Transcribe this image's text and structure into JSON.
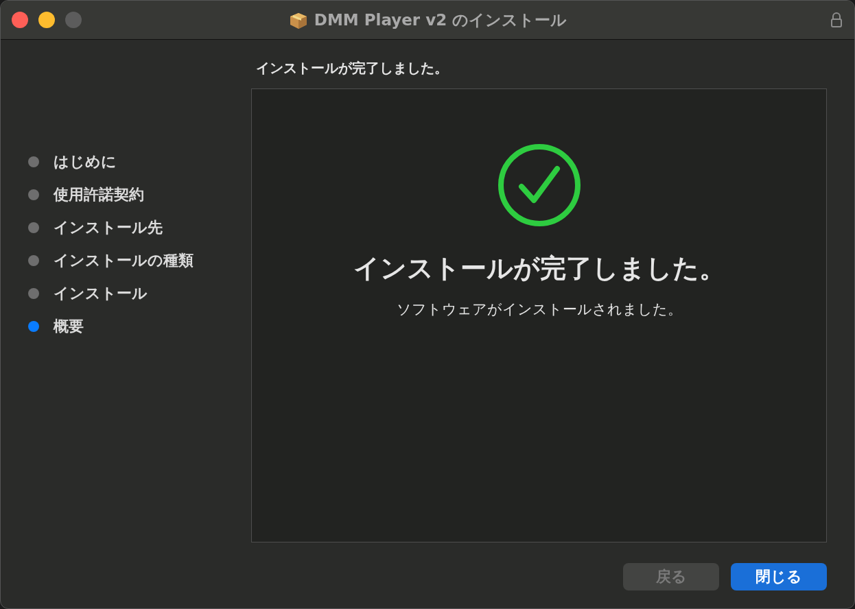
{
  "window": {
    "title": "DMM Player v2 のインストール"
  },
  "steps": [
    {
      "label": "はじめに",
      "selected": false
    },
    {
      "label": "使用許諾契約",
      "selected": false
    },
    {
      "label": "インストール先",
      "selected": false
    },
    {
      "label": "インストールの種類",
      "selected": false
    },
    {
      "label": "インストール",
      "selected": false
    },
    {
      "label": "概要",
      "selected": true
    }
  ],
  "header": "インストールが完了しました。",
  "result": {
    "heading": "インストールが完了しました。",
    "message": "ソフトウェアがインストールされました。"
  },
  "buttons": [
    {
      "label": "戻る",
      "disabled": true,
      "primary": false
    },
    {
      "label": "閉じる",
      "disabled": false,
      "primary": true
    }
  ]
}
